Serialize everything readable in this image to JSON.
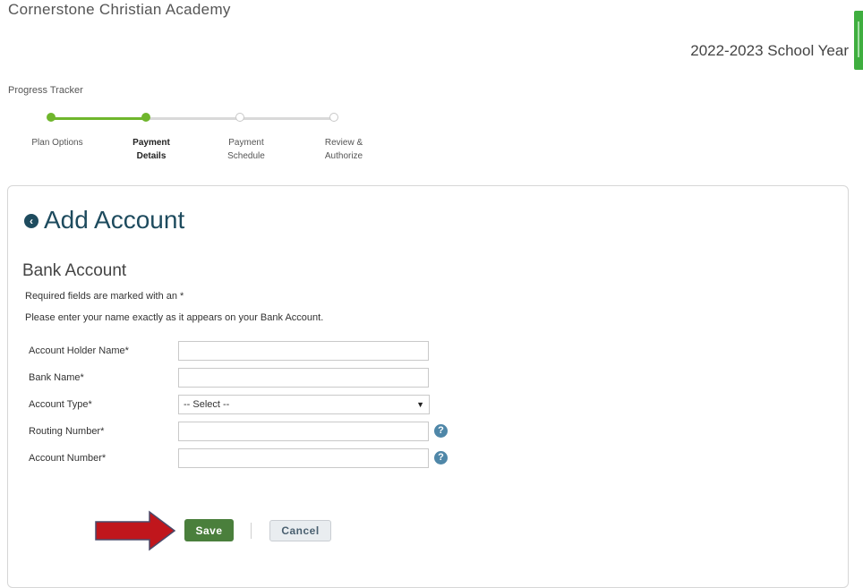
{
  "header": {
    "school_name": "Cornerstone Christian Academy",
    "school_year": "2022-2023 School Year"
  },
  "progress": {
    "title": "Progress Tracker",
    "steps": [
      {
        "line1": "Plan Options",
        "line2": "",
        "state": "done"
      },
      {
        "line1": "Payment",
        "line2": "Details",
        "state": "current"
      },
      {
        "line1": "Payment",
        "line2": "Schedule",
        "state": "todo"
      },
      {
        "line1": "Review &",
        "line2": "Authorize",
        "state": "todo"
      }
    ]
  },
  "page": {
    "title": "Add Account",
    "section_title": "Bank Account",
    "required_note": "Required fields are marked with an *",
    "name_note": "Please enter your name exactly as it appears on your Bank Account."
  },
  "form": {
    "account_holder_label": "Account Holder Name*",
    "account_holder_value": "",
    "bank_name_label": "Bank Name*",
    "bank_name_value": "",
    "account_type_label": "Account Type*",
    "account_type_selected": "-- Select --",
    "routing_number_label": "Routing Number*",
    "routing_number_value": "",
    "account_number_label": "Account Number*",
    "account_number_value": ""
  },
  "actions": {
    "save_label": "Save",
    "cancel_label": "Cancel"
  },
  "colors": {
    "accent_green": "#6fb62c",
    "title_blue": "#1e4b5e",
    "save_green": "#4a7f3c",
    "arrow_red": "#c0161c",
    "help_blue": "#4f87a8"
  }
}
